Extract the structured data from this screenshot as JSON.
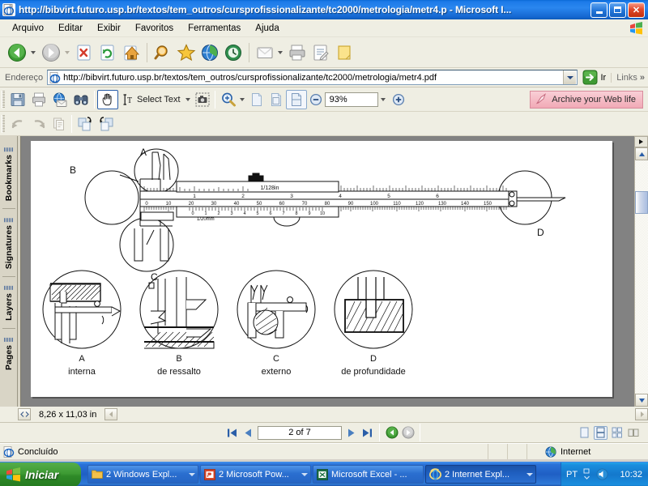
{
  "window": {
    "title": "http://bibvirt.futuro.usp.br/textos/tem_outros/cursprofissionalizante/tc2000/metrologia/metr4.p - Microsoft I...",
    "icon": "ie-page-icon",
    "minimize_label": "Minimizar",
    "maximize_label": "Restaurar",
    "close_label": "Fechar"
  },
  "menubar": {
    "items": [
      {
        "label": "Arquivo",
        "name": "menu-arquivo"
      },
      {
        "label": "Editar",
        "name": "menu-editar"
      },
      {
        "label": "Exibir",
        "name": "menu-exibir"
      },
      {
        "label": "Favoritos",
        "name": "menu-favoritos"
      },
      {
        "label": "Ferramentas",
        "name": "menu-ferramentas"
      },
      {
        "label": "Ajuda",
        "name": "menu-ajuda"
      }
    ]
  },
  "ie_toolbar": {
    "buttons": [
      {
        "name": "back-button",
        "icon": "back-arrow-icon"
      },
      {
        "name": "forward-button",
        "icon": "forward-arrow-icon"
      },
      {
        "name": "stop-button",
        "icon": "stop-icon"
      },
      {
        "name": "refresh-button",
        "icon": "refresh-icon"
      },
      {
        "name": "home-button",
        "icon": "home-icon"
      },
      {
        "name": "search-button",
        "icon": "search-icon"
      },
      {
        "name": "favorites-button",
        "icon": "star-icon"
      },
      {
        "name": "media-button",
        "icon": "media-globe-icon"
      },
      {
        "name": "history-button",
        "icon": "history-clock-icon"
      },
      {
        "name": "mail-button",
        "icon": "mail-icon"
      },
      {
        "name": "print-button",
        "icon": "printer-icon"
      },
      {
        "name": "edit-button",
        "icon": "edit-page-icon"
      },
      {
        "name": "discuss-button",
        "icon": "note-icon"
      }
    ]
  },
  "address_bar": {
    "label": "Endereço",
    "url": "http://bibvirt.futuro.usp.br/textos/tem_outros/cursprofissionalizante/tc2000/metrologia/metr4.pdf",
    "placeholder": "Endereço",
    "go_label": "Ir",
    "links_label": "Links",
    "overflow_label": "»"
  },
  "acrobat_toolbar": {
    "row1": [
      {
        "name": "save-button",
        "icon": "floppy-save-icon",
        "label": "Salvar"
      },
      {
        "name": "print-button",
        "icon": "printer-icon",
        "label": "Imprimir"
      },
      {
        "name": "email-button",
        "icon": "email-globe-icon",
        "label": "E-mail"
      },
      {
        "name": "search-pdf-button",
        "icon": "binoculars-icon",
        "label": "Pesquisar"
      },
      {
        "name": "hand-tool-button",
        "icon": "hand-icon",
        "label": "Mão"
      },
      {
        "name": "select-text-button",
        "icon": "select-text-icon",
        "label": "Select Text"
      },
      {
        "name": "snapshot-button",
        "icon": "camera-snapshot-icon",
        "label": "Instantâneo"
      },
      {
        "name": "zoom-in-tool-button",
        "icon": "magnifier-plus-icon",
        "label": "Zoom"
      },
      {
        "name": "actual-size-button",
        "icon": "page-actual-size-icon",
        "label": "Tamanho real"
      },
      {
        "name": "fit-page-button",
        "icon": "page-fit-icon",
        "label": "Ajustar página"
      },
      {
        "name": "fit-width-button",
        "icon": "page-fit-width-icon",
        "label": "Ajustar largura"
      },
      {
        "name": "zoom-out-button",
        "icon": "minus-circle-icon",
        "label": "Reduzir"
      },
      {
        "name": "zoom-in-button",
        "icon": "plus-circle-icon",
        "label": "Ampliar"
      }
    ],
    "select_text_label": "Select Text",
    "zoom_value": "93%",
    "row2": [
      {
        "name": "undo-button",
        "icon": "undo-arrow-icon",
        "label": "Desfazer"
      },
      {
        "name": "redo-button",
        "icon": "redo-arrow-icon",
        "label": "Refazer"
      },
      {
        "name": "copy-button",
        "icon": "copy-pages-icon",
        "label": "Copiar"
      },
      {
        "name": "rotate-cw-button",
        "icon": "rotate-clockwise-icon",
        "label": "Girar à direita"
      },
      {
        "name": "rotate-ccw-button",
        "icon": "rotate-counterclockwise-icon",
        "label": "Girar à esquerda"
      }
    ]
  },
  "archive_button": {
    "label": "Archive your Web life",
    "icon": "archive-rocket-icon",
    "bg_color": "#f1a9b6"
  },
  "nav_rail": {
    "tabs": [
      {
        "label": "Bookmarks",
        "name": "nav-tab-bookmarks"
      },
      {
        "label": "Signatures",
        "name": "nav-tab-signatures"
      },
      {
        "label": "Layers",
        "name": "nav-tab-layers"
      },
      {
        "label": "Pages",
        "name": "nav-tab-pages"
      }
    ]
  },
  "document": {
    "page_size": "8,26 x 11,03 in",
    "caliper": {
      "callouts": [
        {
          "letter": "A",
          "name": "callout-a"
        },
        {
          "letter": "B",
          "name": "callout-b"
        },
        {
          "letter": "C",
          "name": "callout-c"
        },
        {
          "letter": "D",
          "name": "callout-d"
        }
      ],
      "inch_scale_label": "1/128in",
      "mm_scale_label": "1/20mm",
      "main_scale_mm": [
        "0",
        "10",
        "20",
        "30",
        "40",
        "50",
        "60",
        "70",
        "80",
        "90",
        "100",
        "110",
        "120",
        "130",
        "140",
        "150"
      ],
      "inch_scale": [
        "1",
        "2",
        "3",
        "4",
        "5",
        "6"
      ],
      "vernier_mm": [
        "0",
        "1",
        "2",
        "3",
        "4",
        "5",
        "6",
        "7",
        "8",
        "9",
        "10"
      ]
    },
    "detail_figures": [
      {
        "letter": "A",
        "caption": "interna",
        "name": "detail-figure-a"
      },
      {
        "letter": "B",
        "caption": "de ressalto",
        "name": "detail-figure-b"
      },
      {
        "letter": "C",
        "caption": "externo",
        "name": "detail-figure-c"
      },
      {
        "letter": "D",
        "caption": "de profundidade",
        "name": "detail-figure-d"
      }
    ]
  },
  "page_nav": {
    "first_label": "Primeira página",
    "prev_label": "Página anterior",
    "page_indicator": "2 of 7",
    "next_label": "Próxima página",
    "last_label": "Última página",
    "prev_view_label": "Exibição anterior",
    "next_view_label": "Próxima exibição",
    "layout_buttons": [
      {
        "name": "layout-single-page-button",
        "label": "Página única"
      },
      {
        "name": "layout-continuous-button",
        "label": "Contínua"
      },
      {
        "name": "layout-facing-button",
        "label": "Frente a frente"
      },
      {
        "name": "layout-continuous-facing-button",
        "label": "Contínua frente a frente"
      }
    ],
    "active_layout": "layout-continuous-button"
  },
  "status_bar": {
    "status_text": "Concluído",
    "zone_text": "Internet",
    "zone_icon": "internet-globe-icon"
  },
  "taskbar": {
    "start_label": "Iniciar",
    "tasks": [
      {
        "label": "2 Windows Expl...",
        "icon": "folder-icon",
        "name": "task-windows-explorer"
      },
      {
        "label": "2 Microsoft Pow...",
        "icon": "powerpoint-icon",
        "name": "task-powerpoint"
      },
      {
        "label": "Microsoft Excel - ...",
        "icon": "excel-icon",
        "name": "task-excel"
      },
      {
        "label": "2 Internet Expl...",
        "icon": "ie-icon",
        "name": "task-internet-explorer",
        "active": true
      }
    ],
    "language": "PT",
    "clock": "10:32"
  }
}
